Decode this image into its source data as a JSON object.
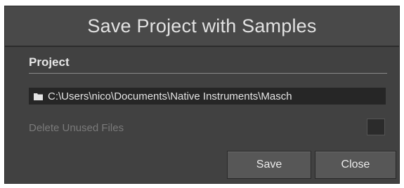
{
  "dialog": {
    "title": "Save Project with Samples"
  },
  "project_section": {
    "label": "Project",
    "path_icon": "folder-icon",
    "path_value": "C:\\Users\\nico\\Documents\\Native Instruments\\Masch"
  },
  "options": {
    "delete_unused_label": "Delete Unused Files",
    "delete_unused_checked": false
  },
  "buttons": {
    "save_label": "Save",
    "close_label": "Close"
  },
  "colors": {
    "dialog_bg": "#414141",
    "title_bg": "#494949",
    "field_bg": "#262626",
    "button_bg": "#575757",
    "disabled_text": "#7a7a7a"
  }
}
